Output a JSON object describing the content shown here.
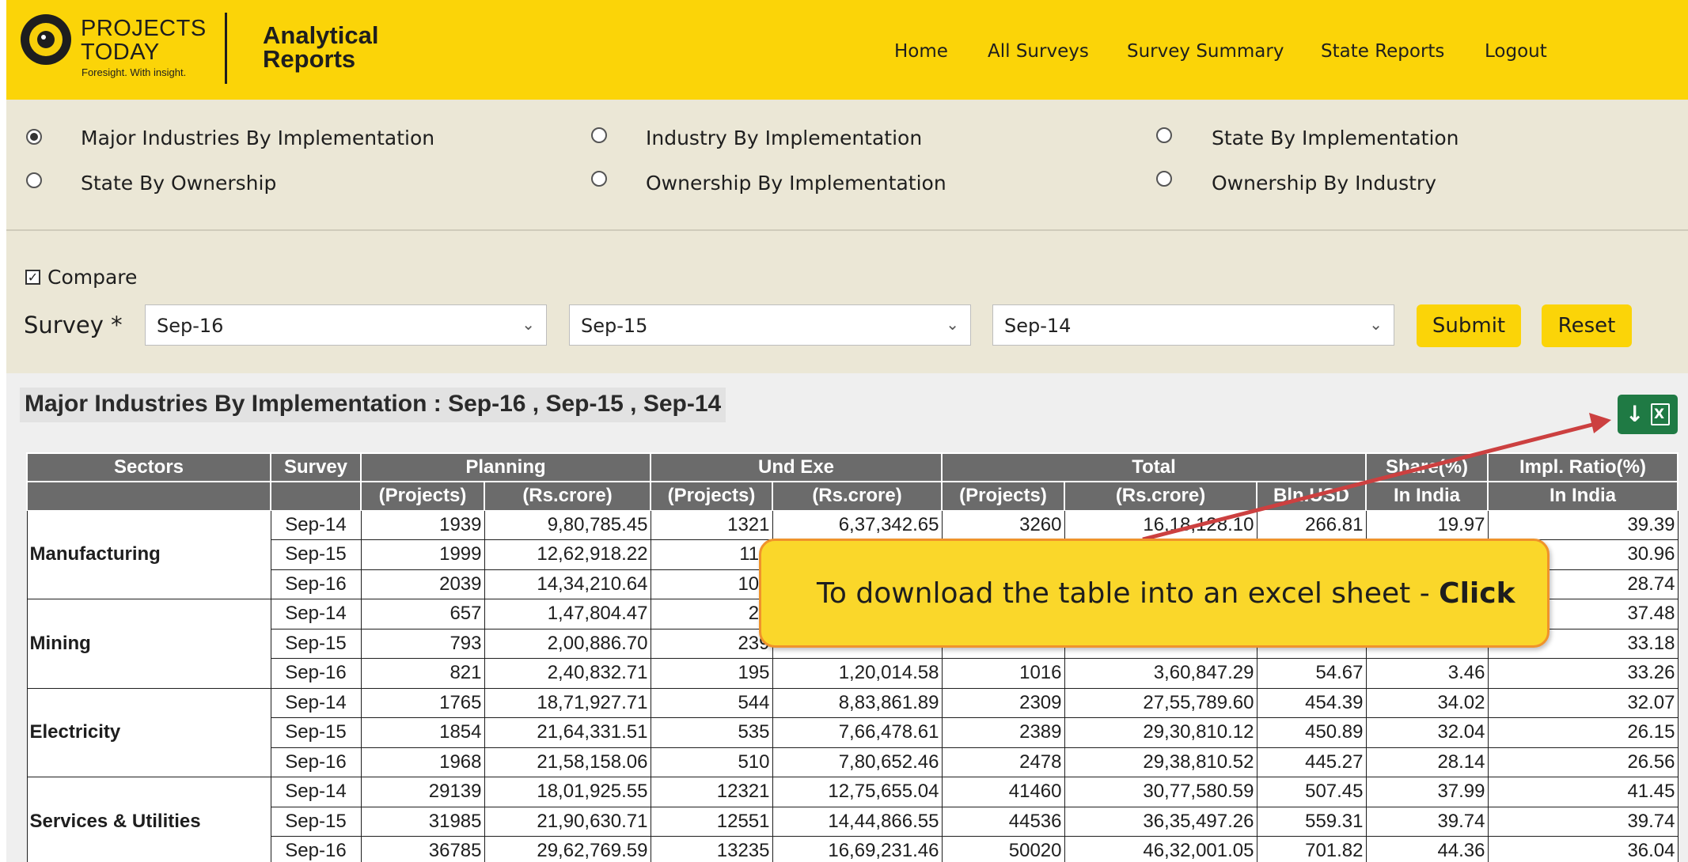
{
  "header": {
    "brand_line1": "PROJECTS",
    "brand_line2": "TODAY",
    "brand_tagline": "Foresight. With insight.",
    "app_line1": "Analytical",
    "app_line2": "Reports",
    "nav": [
      "Home",
      "All Surveys",
      "Survey Summary",
      "State Reports",
      "Logout"
    ]
  },
  "report_types": [
    {
      "label": "Major Industries By Implementation",
      "selected": true
    },
    {
      "label": "Industry By Implementation",
      "selected": false
    },
    {
      "label": "State By Implementation",
      "selected": false
    },
    {
      "label": "State By Ownership",
      "selected": false
    },
    {
      "label": "Ownership By Implementation",
      "selected": false
    },
    {
      "label": "Ownership By Industry",
      "selected": false
    }
  ],
  "compare": {
    "label": "Compare",
    "checked": true
  },
  "survey": {
    "label": "Survey *",
    "selects": [
      "Sep-16",
      "Sep-15",
      "Sep-14"
    ],
    "submit": "Submit",
    "reset": "Reset"
  },
  "report": {
    "title": "Major Industries By Implementation : Sep-16 , Sep-15 , Sep-14",
    "download_icon": "download-excel-icon",
    "header_row1": [
      "Sectors",
      "Survey",
      "Planning",
      "Und Exe",
      "Total",
      "Share(%)",
      "Impl. Ratio(%)"
    ],
    "header_row2": [
      "(Projects)",
      "(Rs.crore)",
      "(Projects)",
      "(Rs.crore)",
      "(Projects)",
      "(Rs.crore)",
      "Bln.USD",
      "In India",
      "In India"
    ],
    "sectors": [
      {
        "name": "Manufacturing",
        "rows": [
          [
            "Sep-14",
            "1939",
            "9,80,785.45",
            "1321",
            "6,37,342.65",
            "3260",
            "16,18,128.10",
            "266.81",
            "19.97",
            "39.39"
          ],
          [
            "Sep-15",
            "1999",
            "12,62,918.22",
            "114",
            "",
            "",
            "",
            "",
            "",
            "30.96"
          ],
          [
            "Sep-16",
            "2039",
            "14,34,210.64",
            "105",
            "",
            "",
            "",
            "",
            "",
            "28.74"
          ]
        ]
      },
      {
        "name": "Mining",
        "rows": [
          [
            "Sep-14",
            "657",
            "1,47,804.47",
            "23",
            "",
            "",
            "",
            "",
            "",
            "37.48"
          ],
          [
            "Sep-15",
            "793",
            "2,00,886.70",
            "239",
            "",
            "",
            "",
            "",
            "",
            "33.18"
          ],
          [
            "Sep-16",
            "821",
            "2,40,832.71",
            "195",
            "1,20,014.58",
            "1016",
            "3,60,847.29",
            "54.67",
            "3.46",
            "33.26"
          ]
        ]
      },
      {
        "name": "Electricity",
        "rows": [
          [
            "Sep-14",
            "1765",
            "18,71,927.71",
            "544",
            "8,83,861.89",
            "2309",
            "27,55,789.60",
            "454.39",
            "34.02",
            "32.07"
          ],
          [
            "Sep-15",
            "1854",
            "21,64,331.51",
            "535",
            "7,66,478.61",
            "2389",
            "29,30,810.12",
            "450.89",
            "32.04",
            "26.15"
          ],
          [
            "Sep-16",
            "1968",
            "21,58,158.06",
            "510",
            "7,80,652.46",
            "2478",
            "29,38,810.52",
            "445.27",
            "28.14",
            "26.56"
          ]
        ]
      },
      {
        "name": "Services & Utilities",
        "rows": [
          [
            "Sep-14",
            "29139",
            "18,01,925.55",
            "12321",
            "12,75,655.04",
            "41460",
            "30,77,580.59",
            "507.45",
            "37.99",
            "41.45"
          ],
          [
            "Sep-15",
            "31985",
            "21,90,630.71",
            "12551",
            "14,44,866.55",
            "44536",
            "36,35,497.26",
            "559.31",
            "39.74",
            "39.74"
          ],
          [
            "Sep-16",
            "36785",
            "29,62,769.59",
            "13235",
            "16,69,231.46",
            "50020",
            "46,32,001.05",
            "701.82",
            "44.36",
            "36.04"
          ]
        ]
      }
    ]
  },
  "callout": {
    "text": "To download the table into an excel sheet - ",
    "emphasis": "Click"
  }
}
